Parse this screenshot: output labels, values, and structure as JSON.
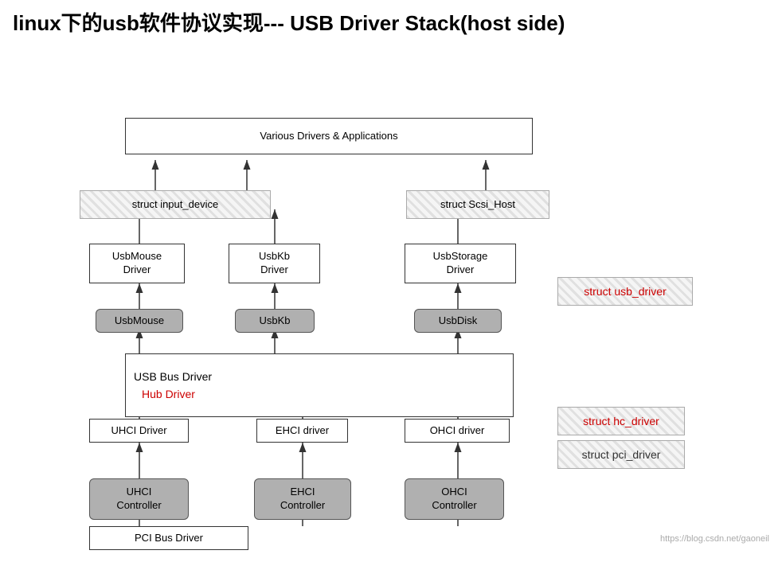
{
  "title": "linux下的usb软件协议实现--- USB Driver Stack(host side)",
  "boxes": {
    "various_drivers": {
      "label": "Various Drivers & Applications"
    },
    "struct_input": {
      "label": "struct input_device"
    },
    "struct_scsi": {
      "label": "struct Scsi_Host"
    },
    "usbmouse_driver": {
      "label": "UsbMouse\nDriver"
    },
    "usbkb_driver": {
      "label": "UsbKb\nDriver"
    },
    "usbstorage_driver": {
      "label": "UsbStorage\nDriver"
    },
    "usbmouse": {
      "label": "UsbMouse"
    },
    "usbkb": {
      "label": "UsbKb"
    },
    "usbdisk": {
      "label": "UsbDisk"
    },
    "usb_bus_driver": {
      "label": "USB Bus Driver"
    },
    "hub_driver": {
      "label": "Hub Driver"
    },
    "uhci_driver": {
      "label": "UHCI Driver"
    },
    "ehci_driver": {
      "label": "EHCI driver"
    },
    "ohci_driver": {
      "label": "OHCI driver"
    },
    "uhci_controller": {
      "label": "UHCI\nController"
    },
    "ehci_controller": {
      "label": "EHCI\nController"
    },
    "ohci_controller": {
      "label": "OHCI\nController"
    },
    "pci_bus_driver": {
      "label": "PCI Bus Driver"
    }
  },
  "labels": {
    "struct_usb_driver": "struct usb_driver",
    "struct_hc_driver": "struct hc_driver",
    "struct_pci_driver": "struct pci_driver",
    "hub_driver_red": "Hub Driver",
    "watermark": "https://blog.csdn.net/gaoneil"
  }
}
